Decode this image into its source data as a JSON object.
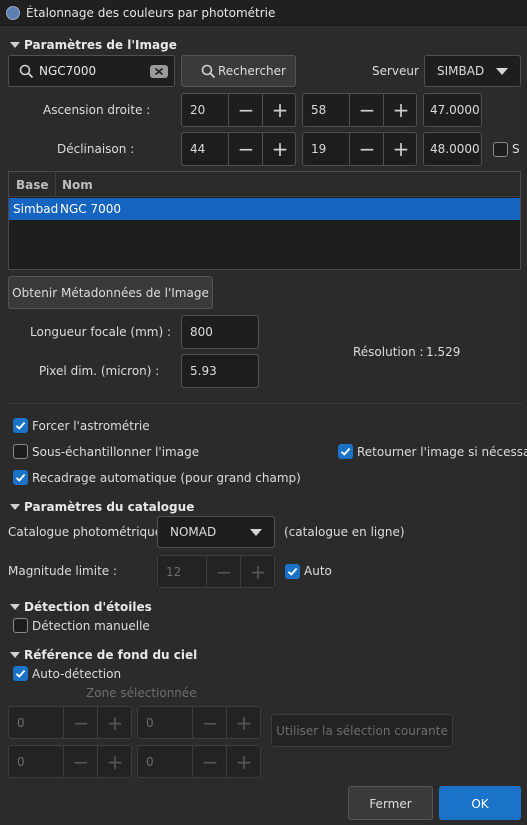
{
  "window": {
    "title": "Étalonnage des couleurs par photométrie"
  },
  "image_params": {
    "title": "Paramètres de l'Image",
    "search_value": "NGC7000",
    "search_button": "Rechercher",
    "server_label": "Serveur :",
    "server_value": "SIMBAD",
    "ra_label": "Ascension droite :",
    "ra_h": "20",
    "ra_m": "58",
    "ra_s": "47.0000",
    "dec_label": "Déclinaison :",
    "dec_d": "44",
    "dec_m": "19",
    "dec_s": "48.0000",
    "south_label": "S",
    "table": {
      "col_base": "Base",
      "col_name": "Nom",
      "row_base": "Simbad",
      "row_name": "NGC 7000"
    },
    "metadata_button": "Obtenir Métadonnées de l'Image",
    "focal_label": "Longueur focale (mm) :",
    "focal_value": "800",
    "pixel_label": "Pixel dim. (micron) :",
    "pixel_value": "5.93",
    "resolution_label": "Résolution :",
    "resolution_value": "1.529"
  },
  "options": {
    "force_astrometry": "Forcer l'astrométrie",
    "downsample": "Sous-échantillonner l'image",
    "flip": "Retourner l'image si nécessaire",
    "autocrop": "Recadrage automatique (pour grand champ)"
  },
  "catalog": {
    "title": "Paramètres du catalogue",
    "photometric_label": "Catalogue photométrique :",
    "photometric_value": "NOMAD",
    "online_note": "(catalogue en ligne)",
    "mag_label": "Magnitude limite :",
    "mag_value": "12",
    "auto_label": "Auto"
  },
  "star_detection": {
    "title": "Détection d'étoiles",
    "manual_label": "Détection manuelle"
  },
  "background": {
    "title": "Référence de fond du ciel",
    "auto_label": "Auto-détection",
    "zone_label": "Zone sélectionnée",
    "x": "0",
    "y": "0",
    "w": "0",
    "h": "0",
    "use_selection": "Utiliser la sélection courante"
  },
  "footer": {
    "close": "Fermer",
    "ok": "OK"
  },
  "colors": {
    "accent": "#1a73c9",
    "selection": "#1565c0"
  },
  "icons": [
    "search-icon",
    "clear-icon",
    "check-icon",
    "chevron-down-icon",
    "collapse-triangle-icon"
  ]
}
